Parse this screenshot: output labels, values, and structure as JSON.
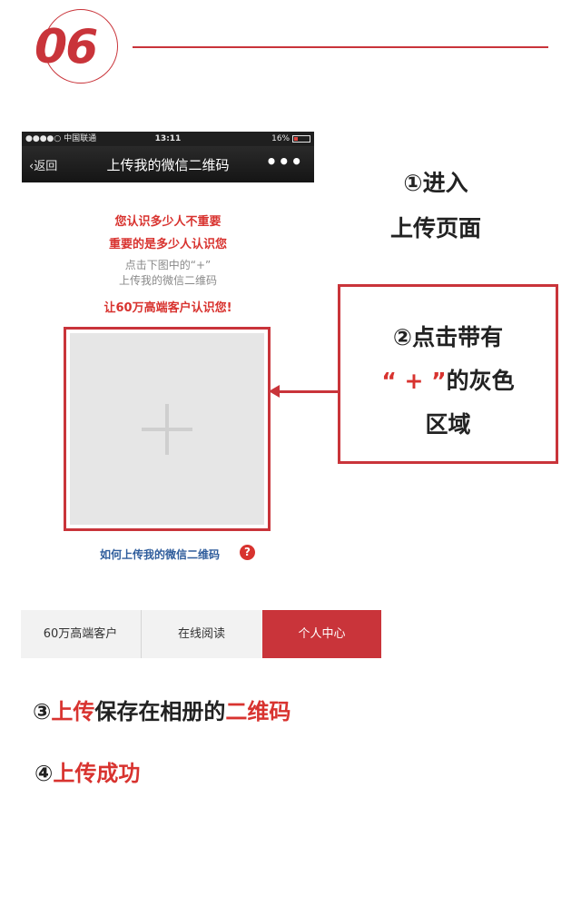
{
  "header": {
    "step_number": "06"
  },
  "phone": {
    "status": {
      "carrier": "●●●●○ 中国联通",
      "time": "13:11",
      "battery": "16%"
    },
    "nav": {
      "back_label": "返回",
      "title": "上传我的微信二维码",
      "more": "•••"
    },
    "lines": {
      "red1": "您认识多少人不重要",
      "red2": "重要的是多少人认识您",
      "grey1": "点击下图中的“+”",
      "grey2": "上传我的微信二维码",
      "red3": "让60万高端客户认识您!"
    },
    "help": {
      "label": "如何上传我的微信二维码",
      "icon": "?"
    }
  },
  "step1": {
    "line1": "①进入",
    "line2": "上传页面"
  },
  "step2": {
    "line1": "②点击带有",
    "line2_red": "“ + ”",
    "line2_rest": "的灰色",
    "line3": "区域"
  },
  "tabs": [
    {
      "label": "60万高端客户"
    },
    {
      "label": "在线阅读"
    },
    {
      "label": "个人中心"
    }
  ],
  "step3": {
    "num": "③",
    "part1_red": "上传",
    "part2": "保存在相册的",
    "part3_red": "二维码"
  },
  "step4": {
    "num": "④",
    "text_red": "上传成功"
  },
  "colors": {
    "accent": "#c9343a",
    "text_red": "#d8332f",
    "link_blue": "#2f5d9c"
  }
}
